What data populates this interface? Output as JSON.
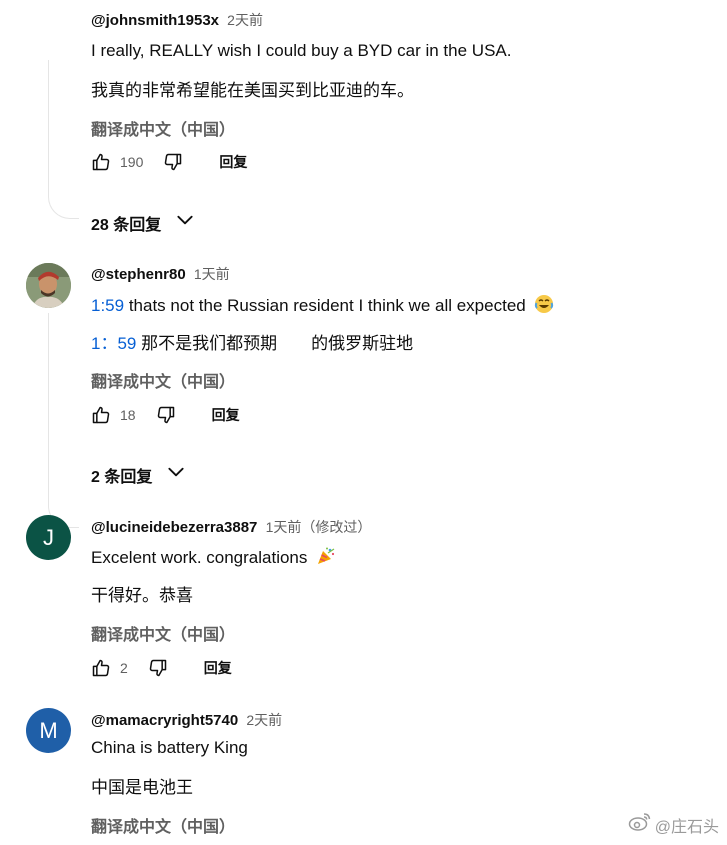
{
  "comments": [
    {
      "author": "@johnsmith1953x",
      "time": "2天前",
      "text": "I really, REALLY wish I could buy a BYD car in the USA.",
      "translated": "我真的非常希望能在美国买到比亚迪的车。",
      "translate_label": "翻译成中文（中国）",
      "likes": "190",
      "reply_label": "回复",
      "replies_label": "28 条回复"
    },
    {
      "author": "@stephenr80",
      "time": "1天前",
      "timestamp_link": "1:59",
      "text": "thats not the Russian resident I think we all expected",
      "emoji": "😂",
      "translated_timestamp": "1：59",
      "translated": "那不是我们都预期　　的俄罗斯驻地",
      "translate_label": "翻译成中文（中国）",
      "likes": "18",
      "reply_label": "回复",
      "replies_label": "2 条回复"
    },
    {
      "author": "@lucineidebezerra3887",
      "time": "1天前（修改过）",
      "avatar_letter": "J",
      "avatar_color": "#0b5345",
      "text": "Excelent work. congralations",
      "emoji": "🎉",
      "translated": "干得好。恭喜",
      "translate_label": "翻译成中文（中国）",
      "likes": "2",
      "reply_label": "回复"
    },
    {
      "author": "@mamacryright5740",
      "time": "2天前",
      "avatar_letter": "M",
      "avatar_color": "#1f5fa8",
      "text": "China is battery King",
      "translated": "中国是电池王",
      "translate_label": "翻译成中文（中国）"
    }
  ],
  "watermark": "@庄石头",
  "icons": {
    "like": "thumbs-up-icon",
    "dislike": "thumbs-down-icon",
    "chevron": "chevron-down-icon",
    "weibo": "weibo-icon"
  }
}
